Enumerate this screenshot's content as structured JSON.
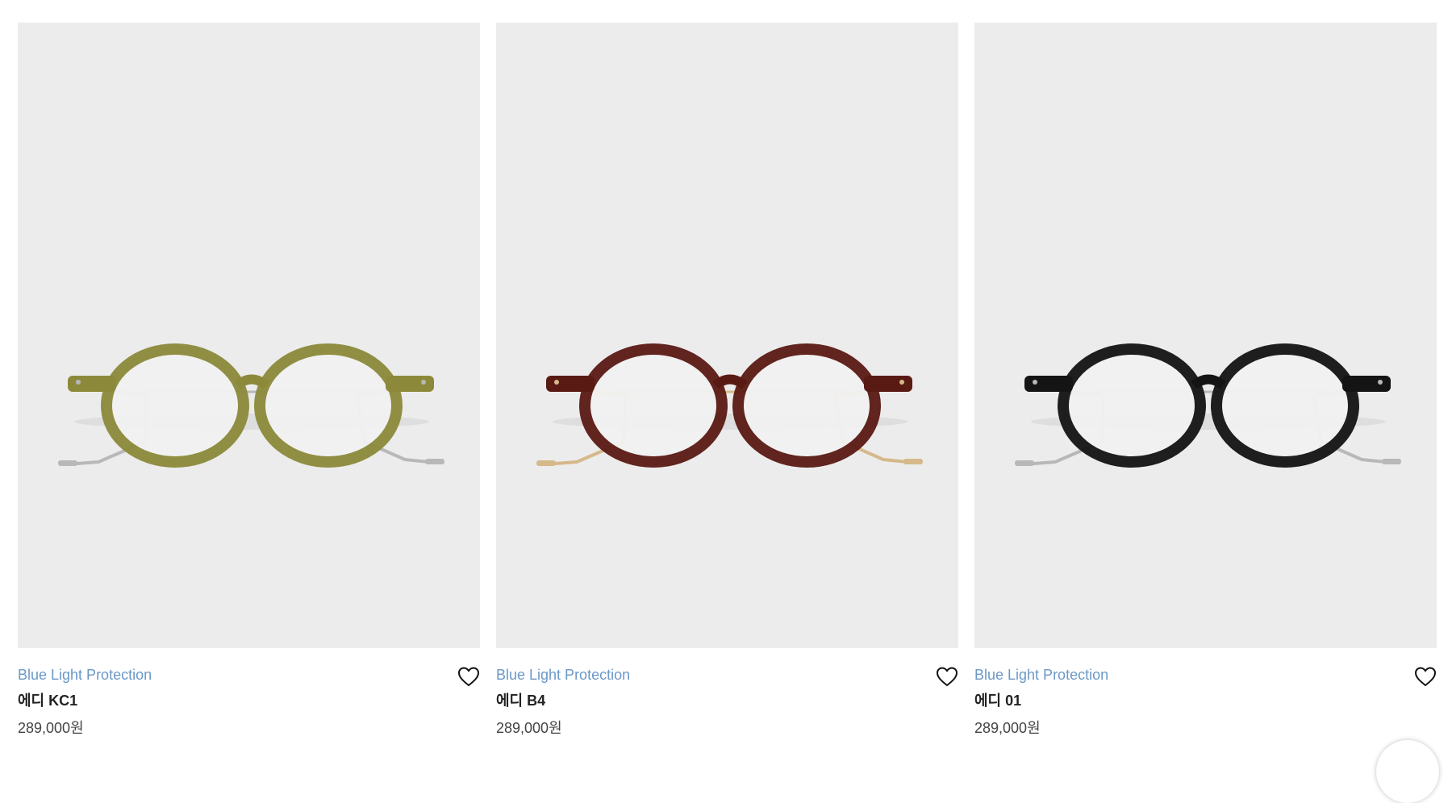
{
  "products": [
    {
      "tag": "Blue Light Protection",
      "name": "에디 KC1",
      "price": "289,000원",
      "frame_color": "#8c8a3a",
      "metal_color": "#b8b8b8"
    },
    {
      "tag": "Blue Light Protection",
      "name": "에디 B4",
      "price": "289,000원",
      "frame_color": "#5a1a14",
      "metal_color": "#d6b98a"
    },
    {
      "tag": "Blue Light Protection",
      "name": "에디 01",
      "price": "289,000원",
      "frame_color": "#141414",
      "metal_color": "#b8b8b8"
    }
  ],
  "icons": {
    "wishlist": "heart-outline-icon",
    "glasses": "eyeglasses-product-image"
  }
}
